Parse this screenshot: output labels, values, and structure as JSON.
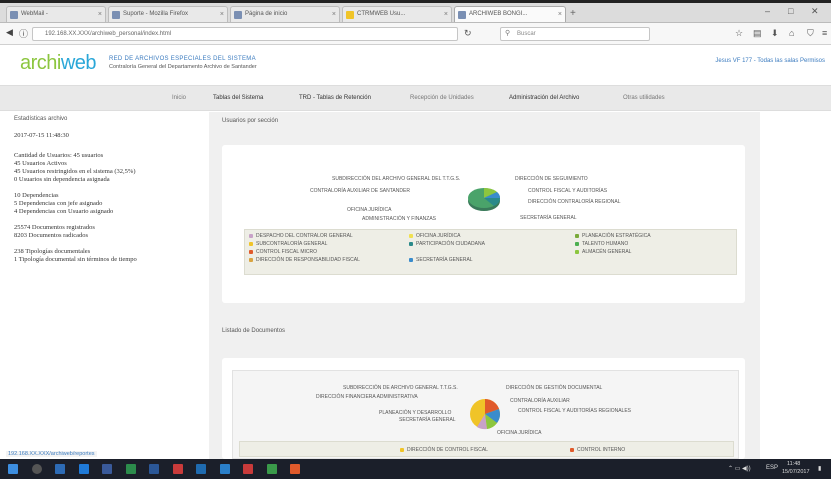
{
  "browser": {
    "tabs": [
      {
        "label": "WebMail -",
        "active": false
      },
      {
        "label": "Suporte - Mozilla Firefox",
        "active": false
      },
      {
        "label": "Página de inicio",
        "active": false
      },
      {
        "label": "CTRMWEB Usu...",
        "active": false
      },
      {
        "label": "ARCHIWEB BONGI...",
        "active": true
      }
    ],
    "url": "192.168.XX.XXX/archiweb_personal/index.html",
    "search_placeholder": "Buscar"
  },
  "app": {
    "logo_part1": "archi",
    "logo_part2": "web",
    "title": "RED DE ARCHIVOS ESPECIALES DEL SISTEMA",
    "subtitle": "Contraloría General del Departamento Archivo de Santander",
    "user_link": "Jesus VF 177 - Todas las salas Permisos",
    "menu": [
      {
        "label": "Inicio",
        "light": true
      },
      {
        "label": "Tablas del Sistema",
        "light": false
      },
      {
        "label": "TRD - Tablas de Retención",
        "light": false
      },
      {
        "label": "Recepción de Unidades",
        "light": true
      },
      {
        "label": "Administración del Archivo",
        "light": false
      },
      {
        "label": "Otras utilidades",
        "light": true
      }
    ]
  },
  "left_panel": {
    "title": "Estadísticas archivo",
    "timestamp": "2017-07-15 11:48:30",
    "block1": [
      "Cantidad de Usuarios: 45 usuarios",
      "45 Usuarios Activos",
      "45 Usuarios restringidos en el sistema (32,5%)",
      "0 Usuarios sin dependencia asignada"
    ],
    "block2": [
      "10 Dependencias",
      "5 Dependencias con jefe asignado",
      "4 Dependencias con Usuario asignado"
    ],
    "block3": [
      "25574 Documentos registrados",
      "8203 Documentos radicados"
    ],
    "block4": [
      "238 Tipologías documentales",
      "1 Tipología documental sin términos de tiempo"
    ]
  },
  "charts": {
    "section1_title": "Usuarios por sección",
    "section2_title": "Listado de Documentos",
    "chart1_labels": [
      "SUBDIRECCIÓN DEL ARCHIVO GENERAL DEL T.T.G.S.",
      "DIRECCIÓN DE SEGUIMIENTO",
      "CONTRALORÍA AUXILIAR DE SANTANDER",
      "CONTROL FISCAL Y AUDITORÍAS",
      "DIRECCIÓN CONTRALORÍA REGIONAL",
      "SECRETARÍA GENERAL",
      "OFICINA JURÍDICA",
      "ADMINISTRACIÓN Y FINANZAS"
    ],
    "chart1_legend": [
      {
        "label": "DESPACHO DEL CONTRALOR GENERAL",
        "color": "#c8a2c8"
      },
      {
        "label": "SUBCONTRALORÍA GENERAL",
        "color": "#f0c428"
      },
      {
        "label": "CONTROL FISCAL MICRO",
        "color": "#e05a2b"
      },
      {
        "label": "DIRECCIÓN DE RESPONSABILIDAD FISCAL",
        "color": "#d9a441"
      },
      {
        "label": "OFICINA JURÍDICA",
        "color": "#f0e050"
      },
      {
        "label": "PARTICIPACIÓN CIUDADANA",
        "color": "#2a8a8a"
      },
      {
        "label": "SECRETARÍA GENERAL",
        "color": "#3a8ccc"
      },
      {
        "label": "PLANEACIÓN ESTRATÉGICA",
        "color": "#7aaa3a"
      },
      {
        "label": "TALENTO HUMANO",
        "color": "#4caf50"
      },
      {
        "label": "ALMACÉN GENERAL",
        "color": "#8cc63f"
      }
    ],
    "chart2_labels": [
      "SUBDIRECCIÓN DE ARCHIVO GENERAL T.T.G.S.",
      "DIRECCIÓN DE GESTIÓN DOCUMENTAL",
      "DIRECCIÓN FINANCIERA ADMINISTRATIVA",
      "CONTRALORÍA AUXILIAR",
      "CONTROL FISCAL Y AUDITORÍAS REGIONALES",
      "PLANEACIÓN Y DESARROLLO",
      "SECRETARÍA GENERAL",
      "OFICINA JURÍDICA"
    ],
    "chart2_legend": [
      {
        "label": "DIRECCIÓN DE CONTROL FISCAL",
        "color": "#f0c428"
      },
      {
        "label": "CONTROL INTERNO",
        "color": "#e05a2b"
      }
    ]
  },
  "status_url": "192.168.XX.XXX/archiweb/reportes",
  "taskbar": {
    "lang": "ESP",
    "time": "11:48",
    "date": "15/07/2017"
  }
}
